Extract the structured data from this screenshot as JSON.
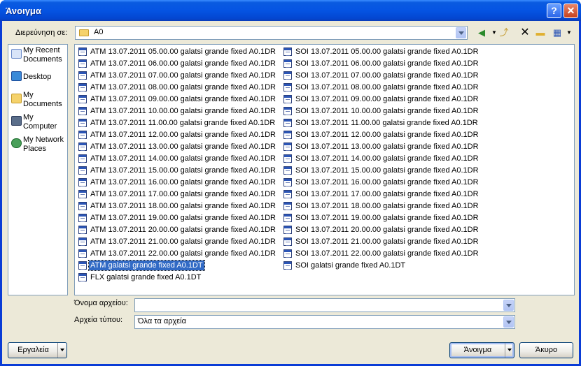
{
  "window": {
    "title": "Άνοιγμα",
    "help_label": "?",
    "close_label": "✕"
  },
  "toolbar": {
    "look_in_label": "Διερεύνηση σε:",
    "look_in_value": "A0"
  },
  "places": [
    {
      "label": "My Recent Documents",
      "icon": "recent-documents-icon"
    },
    {
      "label": "Desktop",
      "icon": "desktop-icon"
    },
    {
      "label": "My Documents",
      "icon": "my-documents-icon"
    },
    {
      "label": "My Computer",
      "icon": "my-computer-icon"
    },
    {
      "label": "My Network Places",
      "icon": "network-places-icon"
    }
  ],
  "files": {
    "column1": [
      "ATM 13.07.2011 05.00.00 galatsi grande fixed A0.1DR",
      "ATM 13.07.2011 06.00.00 galatsi grande fixed A0.1DR",
      "ATM 13.07.2011 07.00.00 galatsi grande fixed A0.1DR",
      "ATM 13.07.2011 08.00.00 galatsi grande fixed A0.1DR",
      "ATM 13.07.2011 09.00.00 galatsi grande fixed A0.1DR",
      "ATM 13.07.2011 10.00.00 galatsi grande fixed A0.1DR",
      "ATM 13.07.2011 11.00.00 galatsi grande fixed A0.1DR",
      "ATM 13.07.2011 12.00.00 galatsi grande fixed A0.1DR",
      "ATM 13.07.2011 13.00.00 galatsi grande fixed A0.1DR",
      "ATM 13.07.2011 14.00.00 galatsi grande fixed A0.1DR",
      "ATM 13.07.2011 15.00.00 galatsi grande fixed A0.1DR",
      "ATM 13.07.2011 16.00.00 galatsi grande fixed A0.1DR",
      "ATM 13.07.2011 17.00.00 galatsi grande fixed A0.1DR",
      "ATM 13.07.2011 18.00.00 galatsi grande fixed A0.1DR",
      "ATM 13.07.2011 19.00.00 galatsi grande fixed A0.1DR",
      "ATM 13.07.2011 20.00.00 galatsi grande fixed A0.1DR",
      "ATM 13.07.2011 21.00.00 galatsi grande fixed A0.1DR",
      "ATM 13.07.2011 22.00.00 galatsi grande fixed A0.1DR",
      "ATM galatsi grande fixed A0.1DT",
      "FLX galatsi grande fixed A0.1DT"
    ],
    "column2": [
      "SOI 13.07.2011 05.00.00 galatsi grande fixed A0.1DR",
      "SOI 13.07.2011 06.00.00 galatsi grande fixed A0.1DR",
      "SOI 13.07.2011 07.00.00 galatsi grande fixed A0.1DR",
      "SOI 13.07.2011 08.00.00 galatsi grande fixed A0.1DR",
      "SOI 13.07.2011 09.00.00 galatsi grande fixed A0.1DR",
      "SOI 13.07.2011 10.00.00 galatsi grande fixed A0.1DR",
      "SOI 13.07.2011 11.00.00 galatsi grande fixed A0.1DR",
      "SOI 13.07.2011 12.00.00 galatsi grande fixed A0.1DR",
      "SOI 13.07.2011 13.00.00 galatsi grande fixed A0.1DR",
      "SOI 13.07.2011 14.00.00 galatsi grande fixed A0.1DR",
      "SOI 13.07.2011 15.00.00 galatsi grande fixed A0.1DR",
      "SOI 13.07.2011 16.00.00 galatsi grande fixed A0.1DR",
      "SOI 13.07.2011 17.00.00 galatsi grande fixed A0.1DR",
      "SOI 13.07.2011 18.00.00 galatsi grande fixed A0.1DR",
      "SOI 13.07.2011 19.00.00 galatsi grande fixed A0.1DR",
      "SOI 13.07.2011 20.00.00 galatsi grande fixed A0.1DR",
      "SOI 13.07.2011 21.00.00 galatsi grande fixed A0.1DR",
      "SOI 13.07.2011 22.00.00 galatsi grande fixed A0.1DR",
      "SOI galatsi grande fixed A0.1DT"
    ],
    "selected": "ATM galatsi grande fixed A0.1DT"
  },
  "form": {
    "filename_label": "Όνομα αρχείου:",
    "filename_value": "",
    "filetype_label": "Αρχεία τύπου:",
    "filetype_value": "Όλα τα αρχεία"
  },
  "buttons": {
    "tools_label": "Εργαλεία",
    "open_label": "Άνοιγμα",
    "cancel_label": "Άκυρο"
  },
  "colors": {
    "title_bar": "#0554e3",
    "selection": "#316ac5",
    "dialog_bg": "#ece9d8"
  }
}
